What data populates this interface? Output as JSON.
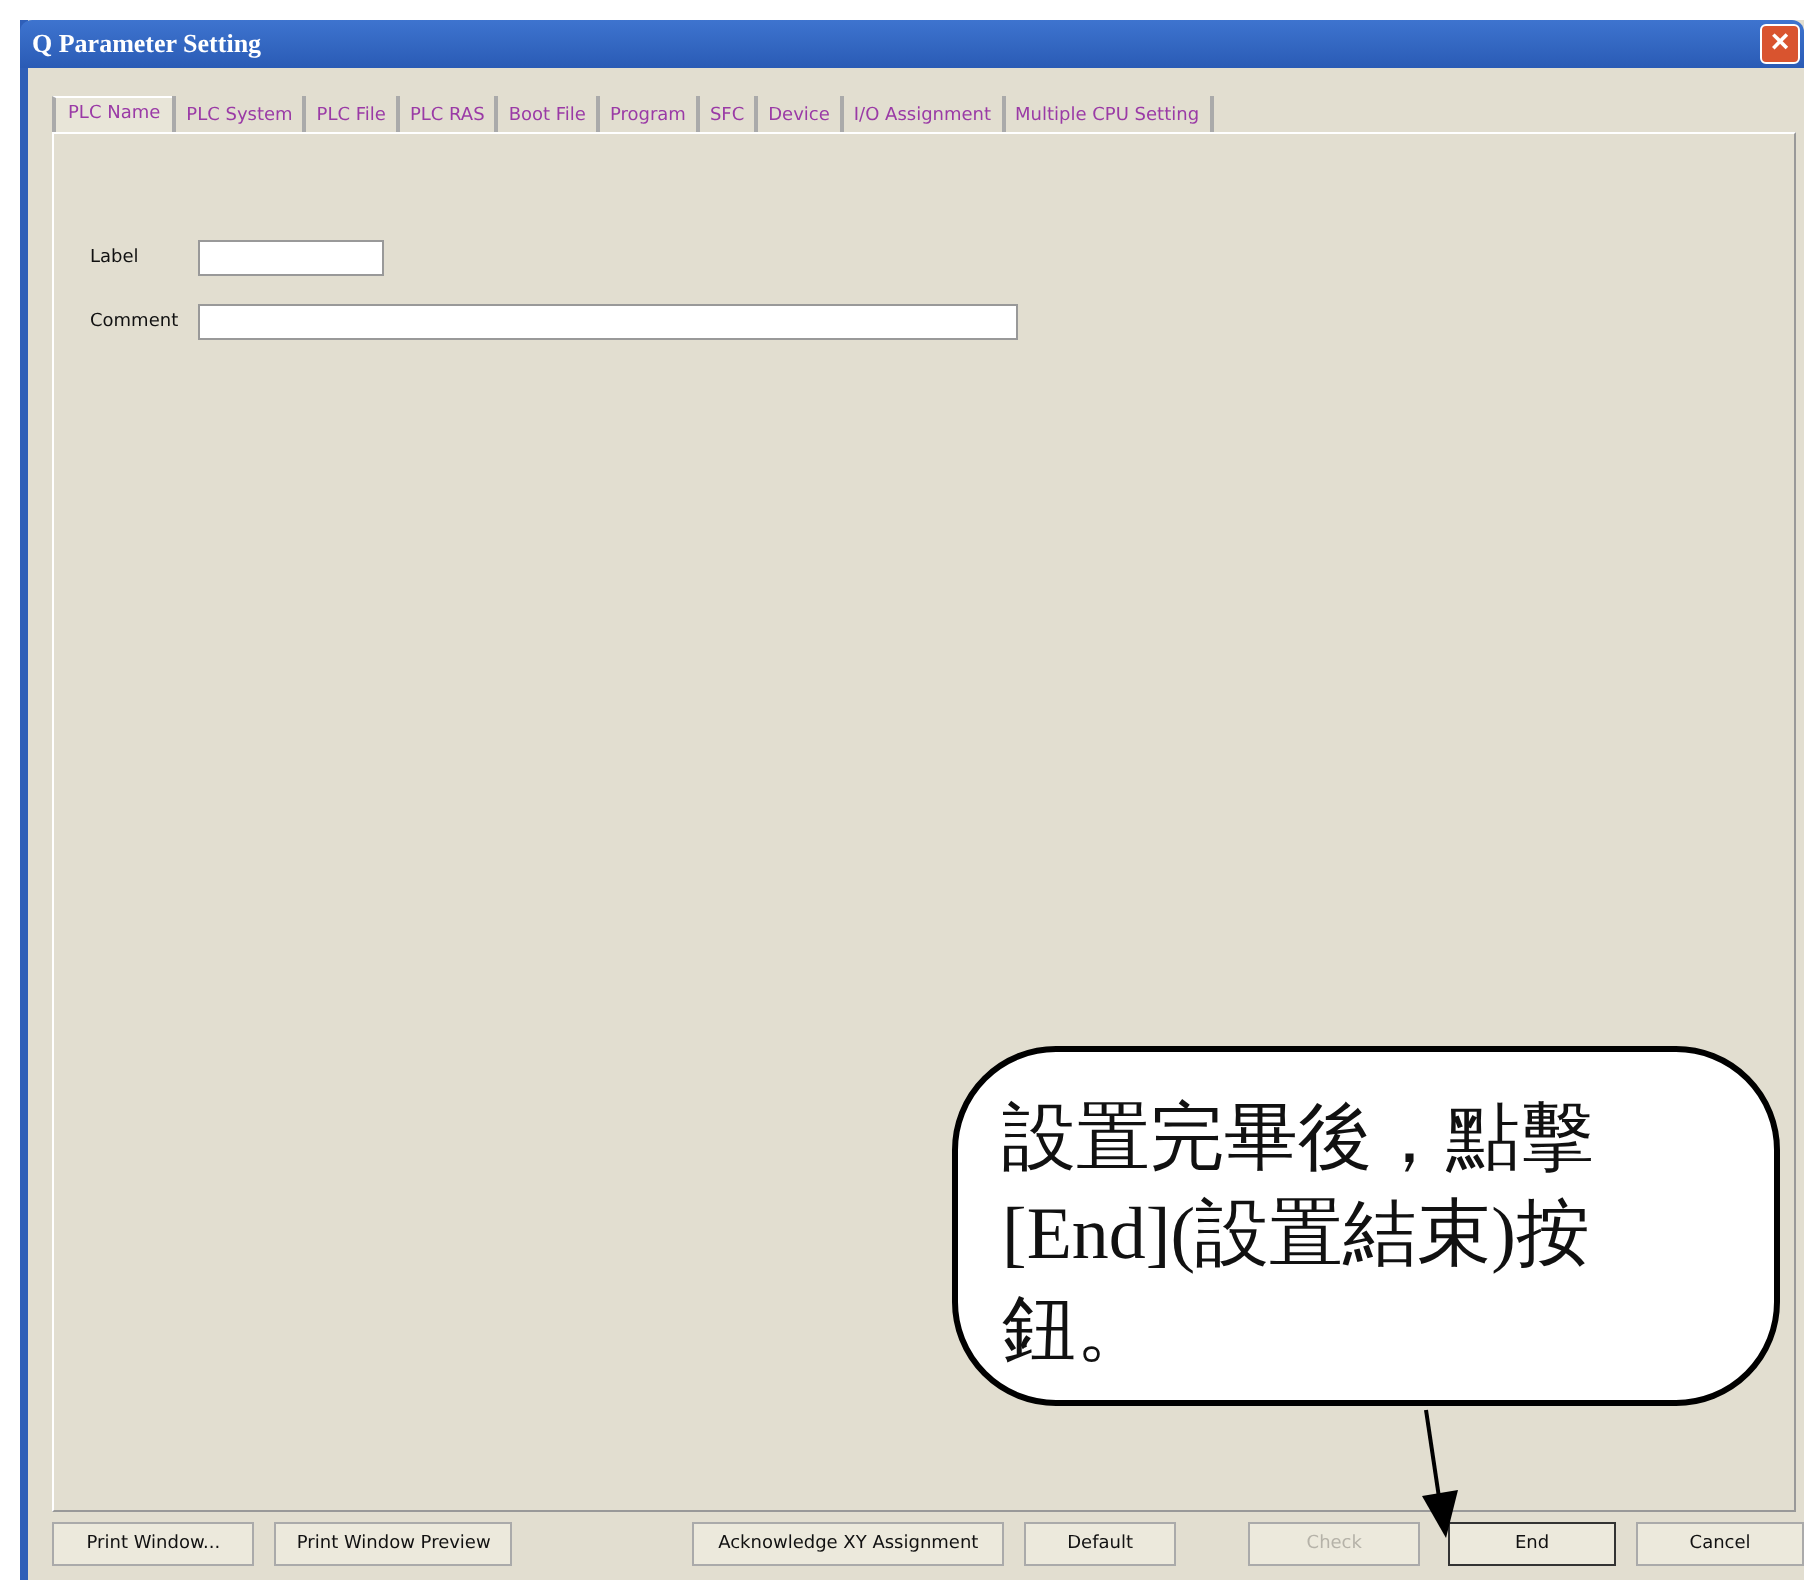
{
  "window": {
    "title": "Q Parameter Setting",
    "close": "×"
  },
  "tabs": [
    {
      "label": "PLC Name",
      "selected": true
    },
    {
      "label": "PLC System",
      "selected": false
    },
    {
      "label": "PLC File",
      "selected": false
    },
    {
      "label": "PLC RAS",
      "selected": false
    },
    {
      "label": "Boot File",
      "selected": false
    },
    {
      "label": "Program",
      "selected": false
    },
    {
      "label": "SFC",
      "selected": false
    },
    {
      "label": "Device",
      "selected": false
    },
    {
      "label": "I/O Assignment",
      "selected": false
    },
    {
      "label": "Multiple CPU Setting",
      "selected": false
    }
  ],
  "fields": [
    {
      "label": "Label",
      "kind": "short"
    },
    {
      "label": "Comment",
      "kind": "long"
    }
  ],
  "buttons": [
    {
      "label": "Print Window...",
      "disabled": false,
      "default": false
    },
    {
      "label": "Print Window Preview",
      "disabled": false,
      "default": false
    },
    {
      "label": "Acknowledge XY Assignment",
      "disabled": false,
      "default": false
    },
    {
      "label": "Default",
      "disabled": false,
      "default": false
    },
    {
      "label": "Check",
      "disabled": true,
      "default": false
    },
    {
      "label": "End",
      "disabled": false,
      "default": true
    },
    {
      "label": "Cancel",
      "disabled": false,
      "default": false
    }
  ],
  "callout": {
    "text": "設置完畢後，點擊[End](設置結束)按鈕。"
  }
}
